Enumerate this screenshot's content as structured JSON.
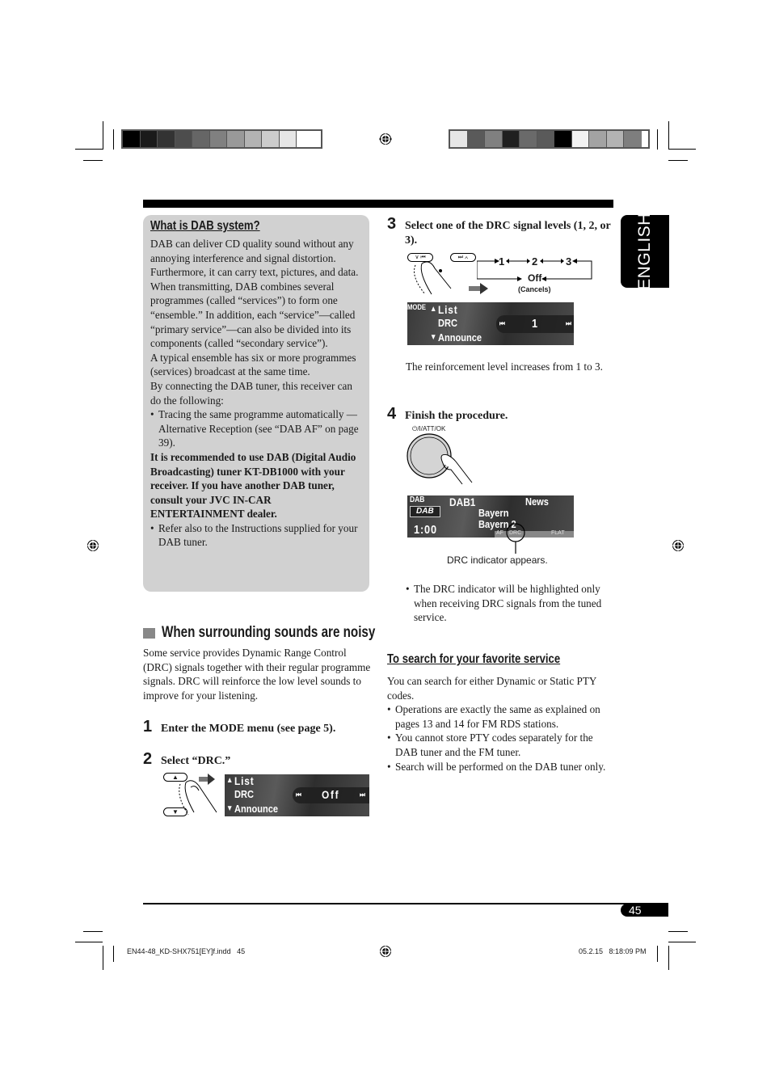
{
  "colors": {
    "box_grey": "#d1d1d1",
    "black": "#000000",
    "section_square": "#888888"
  },
  "print_marks": {
    "left_scale": [
      "#000000",
      "#1a1a1a",
      "#333333",
      "#4d4d4d",
      "#666666",
      "#808080",
      "#999999",
      "#b3b3b3",
      "#cccccc",
      "#e6e6e6",
      "#ffffff"
    ],
    "right_scale": [
      "#e6e6e6",
      "#5a5a5a",
      "#808080",
      "#1f1f1f",
      "#6a6a6a",
      "#5a5a5a",
      "#000000",
      "#f2f2f2",
      "#a3a3a3",
      "#b3b3b3",
      "#7e7e7e"
    ]
  },
  "language_tab": "ENGLISH",
  "page_number": "45",
  "sidebar_box": {
    "title": "What is DAB system?",
    "paragraphs": [
      "DAB can deliver CD quality sound without any annoying interference and signal distortion. Furthermore, it can carry text, pictures, and data. When transmitting, DAB combines several programmes (called “services”) to form one “ensemble.” In addition, each “service”—called “primary service”—can also be divided into its components (called “secondary service”).",
      "A typical ensemble has six or more programmes (services) broadcast at the same time.",
      "By connecting the DAB tuner, this receiver can do the following:"
    ],
    "bullet1": "Tracing the same programme automatically —Alternative Reception (see “DAB AF” on page 39).",
    "bold_note": "It is recommended to use DAB (Digital Audio Broadcasting) tuner KT-DB1000 with your receiver. If you have another DAB tuner, consult your JVC IN-CAR ENTERTAINMENT dealer.",
    "bullet2": "Refer also to the Instructions supplied for your DAB tuner."
  },
  "section": {
    "title": "When surrounding sounds are noisy",
    "intro": "Some service provides Dynamic Range Control (DRC) signals together with their regular programme signals. DRC will reinforce the low level sounds to improve for your listening."
  },
  "steps": [
    {
      "num": "1",
      "text": "Enter the MODE menu (see page 5)."
    },
    {
      "num": "2",
      "text": "Select “DRC.”"
    },
    {
      "num": "3",
      "text": "Select one of the DRC signal levels (1, 2, or 3)."
    },
    {
      "num": "4",
      "text": "Finish the procedure."
    }
  ],
  "lcd_step2": {
    "line1": "List",
    "line2": "DRC",
    "line3": "Announce",
    "value": "Off"
  },
  "step3_diagram": {
    "btn_left": "∨ ⏮",
    "btn_right": "⏭ ∧",
    "cycle": [
      "1",
      "2",
      "3"
    ],
    "off_label": "Off",
    "cancels_label": "(Cancels)"
  },
  "lcd_step3": {
    "mode_label": "MODE",
    "line1": "List",
    "line2": "DRC",
    "line3": "Announce",
    "value": "1"
  },
  "step3_note": "The reinforcement level increases from 1 to 3.",
  "step4_button_label": "⏻/I/ATT/OK",
  "lcd_step4": {
    "source": "DAB",
    "logo": "DAB",
    "time": "1:00",
    "band": "DAB1",
    "pty": "News",
    "service1": "Bayern",
    "service2": "Bayern 2",
    "ind_af": "AF",
    "ind_drc": "DRC",
    "ind_flat": "FLAT"
  },
  "drc_caption": "DRC indicator appears.",
  "drc_bullet": "The DRC indicator will be highlighted only when receiving DRC signals from the tuned service.",
  "search_section": {
    "title": "To search for your favorite service",
    "intro": "You can search for either Dynamic or Static PTY codes.",
    "bullets": [
      "Operations are exactly the same as explained on pages 13 and 14 for FM RDS stations.",
      "You cannot store PTY codes separately for the DAB tuner and the FM tuner.",
      "Search will be performed on the DAB tuner only."
    ]
  },
  "footer": {
    "file": "EN44-48_KD-SHX751[EY]f.indd   45",
    "timestamp": "05.2.15   8:18:09 PM"
  }
}
